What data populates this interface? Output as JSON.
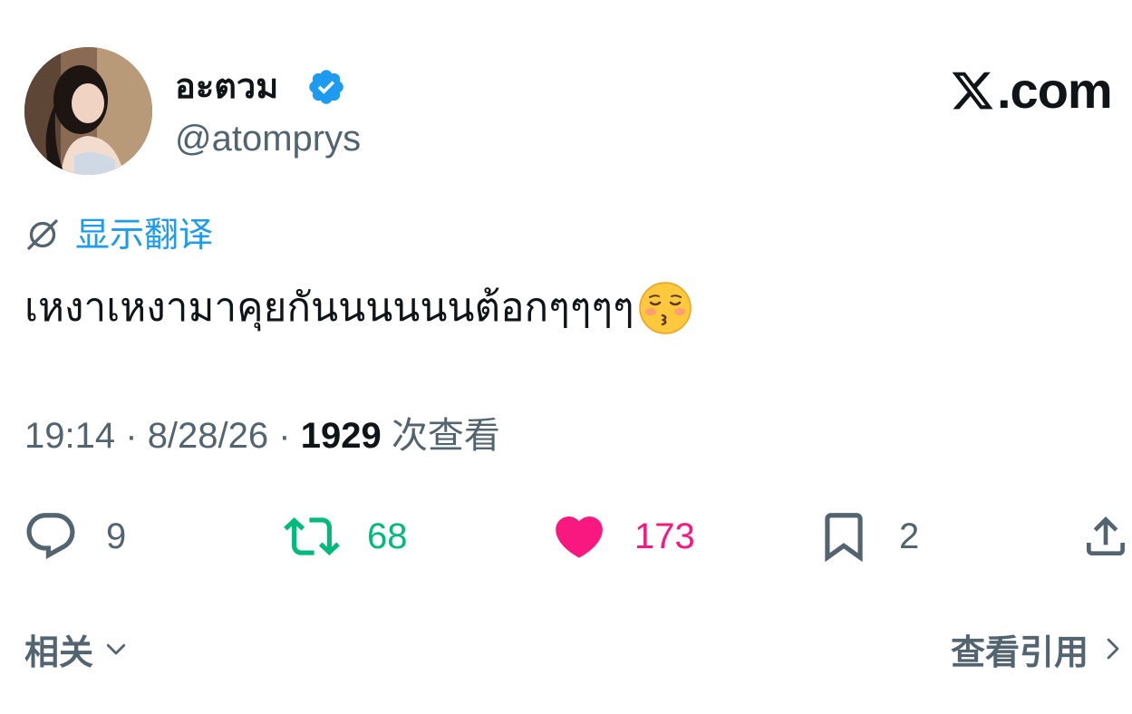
{
  "author": {
    "display_name": "อะตวม",
    "handle": "@atomprys",
    "verified": true
  },
  "brand": {
    "logo_text": ".com",
    "accent_color": "#1d9bf0"
  },
  "translate": {
    "label": "显示翻译"
  },
  "tweet": {
    "text": "เหงาเหงามาคุยกันนนนนนต้อกๆๆๆๆ",
    "emoji": "kissing-face-with-closed-eyes"
  },
  "meta": {
    "time": "19:14",
    "separator": "·",
    "date": "8/28/26",
    "views_count": "1929",
    "views_label": "次查看"
  },
  "actions": {
    "replies": "9",
    "retweets": "68",
    "likes": "173",
    "bookmarks": "2",
    "retweet_color": "#00ba7c",
    "like_color": "#f91880"
  },
  "footer": {
    "related_label": "相关",
    "quotes_label": "查看引用"
  }
}
